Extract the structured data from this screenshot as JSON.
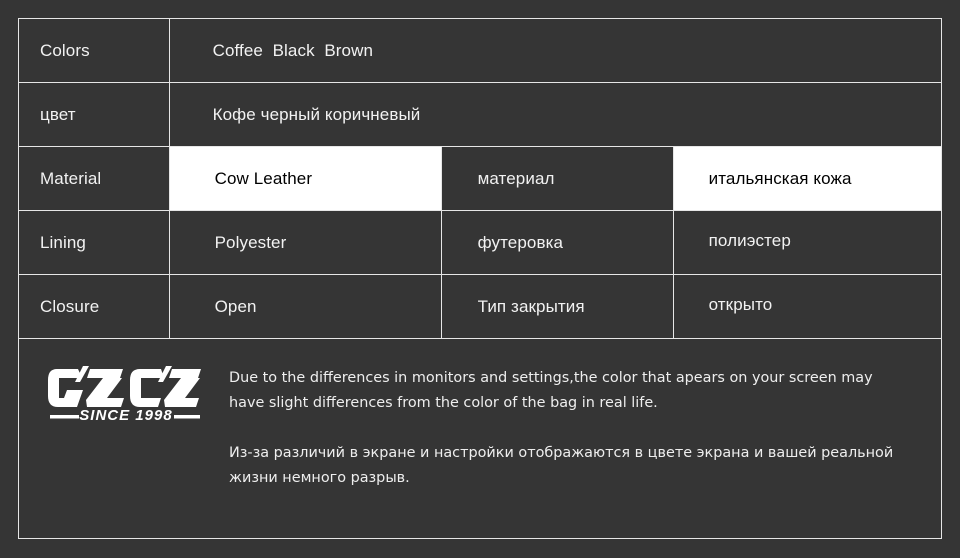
{
  "table": {
    "rows": [
      {
        "type": "two-col",
        "label": "Colors",
        "value": "Coffee  Black  Brown"
      },
      {
        "type": "two-col",
        "label": "цвет",
        "value": "Кофе черный коричневый"
      },
      {
        "type": "four-col",
        "label": "Material",
        "value_en": "Cow Leather",
        "label_ru": "материал",
        "value_ru": "итальянская кожа",
        "highlight": true
      },
      {
        "type": "four-col",
        "label": "Lining",
        "value_en": "Polyester",
        "label_ru": "футеровка",
        "value_ru": "полиэстер",
        "highlight": false
      },
      {
        "type": "four-col",
        "label": "Closure",
        "value_en": "Open",
        "label_ru": "Тип закрытия",
        "value_ru": "открыто",
        "highlight": false
      }
    ]
  },
  "footer": {
    "logo": {
      "wordmark": "GZCZ",
      "tagline": "SINCE 1998"
    },
    "disclaimer_en": "Due to the differences in monitors and settings,the color that apears on your screen may have slight differences from the color of the bag in real life.",
    "disclaimer_ru": "Из-за различий в экране и настройки отображаются в цвете экрана и вашей реальной жизни немного разрыв."
  },
  "colors": {
    "background": "#353535",
    "border": "#e6e6e6",
    "text": "#f2f2f2",
    "highlight_background": "#ffffff",
    "highlight_text": "#000000"
  }
}
